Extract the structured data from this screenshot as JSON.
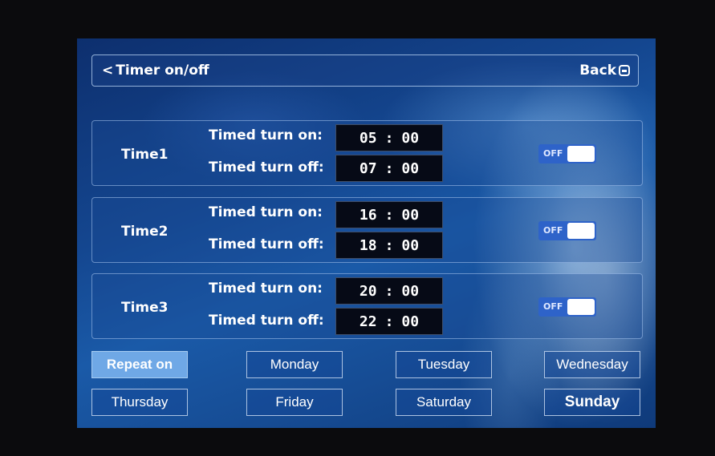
{
  "header": {
    "title": "Timer on/off",
    "back_label": "Back"
  },
  "timers": [
    {
      "name": "Time1",
      "on_label": "Timed turn on:",
      "on_h": "05",
      "on_m": "00",
      "off_label": "Timed turn off:",
      "off_h": "07",
      "off_m": "00",
      "switch": "OFF"
    },
    {
      "name": "Time2",
      "on_label": "Timed turn on:",
      "on_h": "16",
      "on_m": "00",
      "off_label": "Timed turn off:",
      "off_h": "18",
      "off_m": "00",
      "switch": "OFF"
    },
    {
      "name": "Time3",
      "on_label": "Timed turn on:",
      "on_h": "20",
      "on_m": "00",
      "off_label": "Timed turn off:",
      "off_h": "22",
      "off_m": "00",
      "switch": "OFF"
    }
  ],
  "days": {
    "repeat": "Repeat on",
    "monday": "Monday",
    "tuesday": "Tuesday",
    "wednesday": "Wednesday",
    "thursday": "Thursday",
    "friday": "Friday",
    "saturday": "Saturday",
    "sunday": "Sunday"
  },
  "colors": {
    "accent": "#2e63c9",
    "active_button": "#6fa8e6",
    "panel": "#14468f"
  }
}
